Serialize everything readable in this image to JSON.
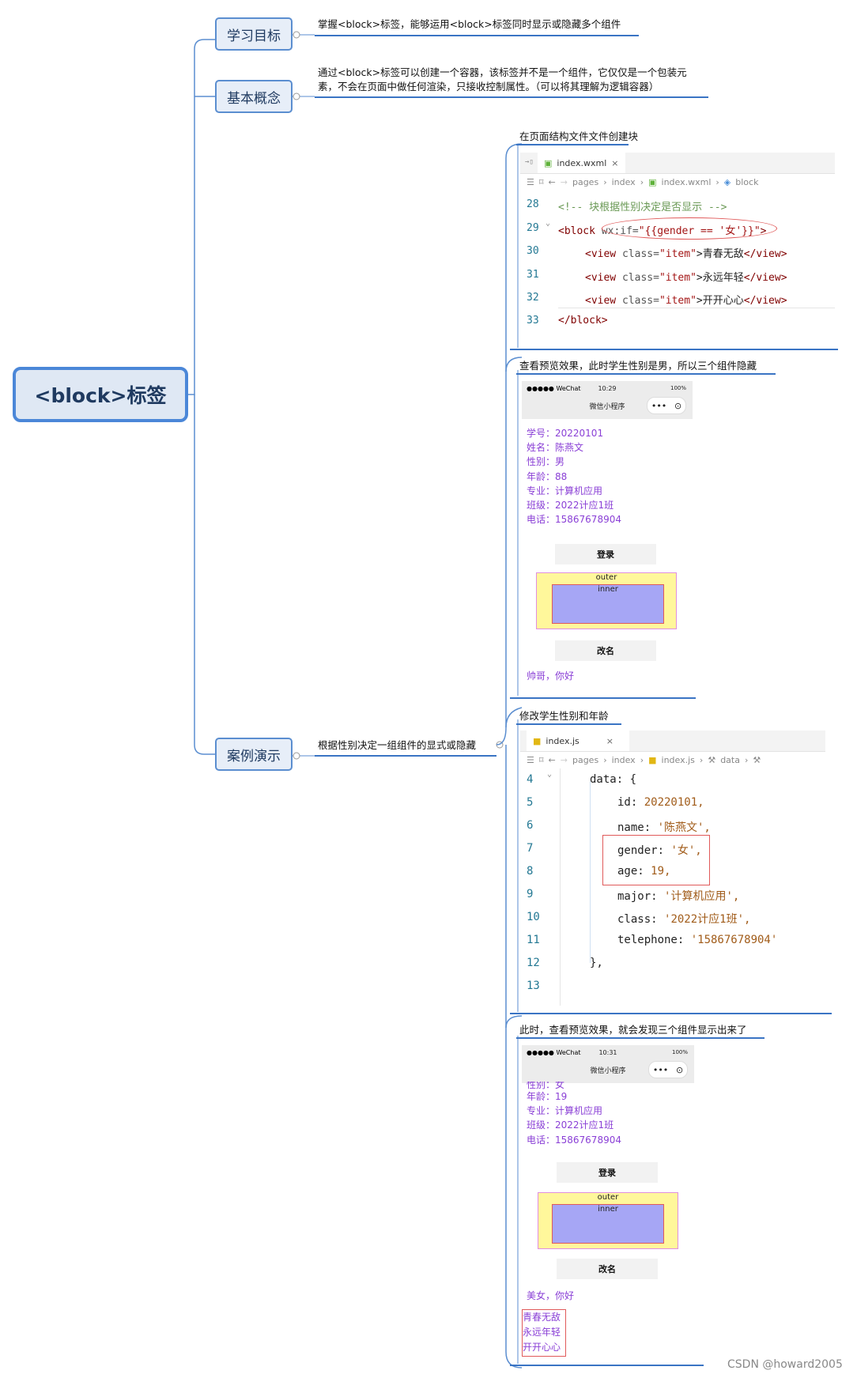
{
  "root": {
    "label": "<block>标签"
  },
  "branches": [
    {
      "label": "学习目标",
      "detail": "掌握<block>标签，能够运用<block>标签同时显示或隐藏多个组件"
    },
    {
      "label": "基本概念",
      "detail_line1": "通过<block>标签可以创建一个容器，该标签并不是一个组件，它仅仅是一个包装元",
      "detail_line2": "素，不会在页面中做任何渲染，只接收控制属性。（可以将其理解为逻辑容器）"
    },
    {
      "label": "案例演示",
      "detail": "根据性别决定一组组件的显式或隐藏"
    }
  ],
  "steps": [
    {
      "caption": "在页面结构文件文件创建块"
    },
    {
      "caption": "查看预览效果，此时学生性别是男，所以三个组件隐藏"
    },
    {
      "caption": "修改学生性别和年龄"
    },
    {
      "caption": "此时，查看预览效果，就会发现三个组件显示出来了"
    }
  ],
  "editor1": {
    "tab": "index.wxml",
    "crumb": [
      "pages",
      "index",
      "index.wxml",
      "block"
    ],
    "lines": [
      {
        "n": "28"
      },
      {
        "n": "29"
      },
      {
        "n": "30"
      },
      {
        "n": "31"
      },
      {
        "n": "32"
      },
      {
        "n": "33"
      }
    ],
    "comment": "<!-- 块根据性别决定是否显示 -->",
    "block_open": "<block",
    "block_attr": " wx:if=",
    "block_val": "\"{{gender == '女'}}\"",
    "tag_open": "<view",
    "tag_class": " class=",
    "class_val": "\"item\"",
    "tag_gt": ">",
    "tag_close": "</view>",
    "items": [
      "青春无敌",
      "永远年轻",
      "开开心心"
    ],
    "block_close": "</block>"
  },
  "phone1": {
    "carrier": "●●●●● WeChat",
    "time": "10:29",
    "battery": "100%",
    "title": "微信小程序",
    "capsule_dots": "•••",
    "capsule_circle": "⊙",
    "info": [
      "学号：20220101",
      "姓名：陈燕文",
      "性别：男",
      "年龄：88",
      "专业：计算机应用",
      "班级：2022计应1班",
      "电话：15867678904"
    ],
    "login": "登录",
    "outer": "outer",
    "inner": "inner",
    "rename": "改名",
    "greeting": "帅哥，你好"
  },
  "editor2": {
    "tab": "index.js",
    "close": "×",
    "crumb": [
      "pages",
      "index",
      "index.js",
      "data"
    ],
    "lines": [
      {
        "n": "4",
        "code": "data: {"
      },
      {
        "n": "5",
        "key": "id: ",
        "val": "20220101,"
      },
      {
        "n": "6",
        "key": "name: ",
        "val": "'陈燕文',"
      },
      {
        "n": "7",
        "key": "gender: ",
        "val": "'女',"
      },
      {
        "n": "8",
        "key": "age: ",
        "val": "19,"
      },
      {
        "n": "9",
        "key": "major: ",
        "val": "'计算机应用',"
      },
      {
        "n": "10",
        "key": "class: ",
        "val": "'2022计应1班',"
      },
      {
        "n": "11",
        "key": "telephone: ",
        "val": "'15867678904'"
      },
      {
        "n": "12",
        "code": "},"
      },
      {
        "n": "13",
        "code": ""
      }
    ]
  },
  "phone2": {
    "carrier": "●●●●● WeChat",
    "time": "10:31",
    "battery": "100%",
    "title": "微信小程序",
    "capsule_dots": "•••",
    "capsule_circle": "⊙",
    "info": [
      "性别：女",
      "年龄：19",
      "专业：计算机应用",
      "班级：2022计应1班",
      "电话：15867678904"
    ],
    "login": "登录",
    "outer": "outer",
    "inner": "inner",
    "rename": "改名",
    "greeting": "美女，你好",
    "items": [
      "青春无敌",
      "永远年轻",
      "开开心心"
    ]
  },
  "watermark": "CSDN @howard2005",
  "colors": {
    "accent": "#3a74c4",
    "purple": "#8a3fd6",
    "highlight": "#e05a5a"
  }
}
